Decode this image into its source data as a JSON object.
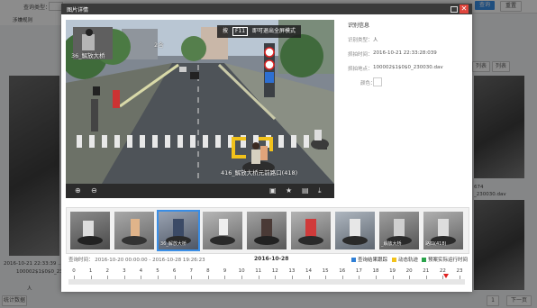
{
  "background": {
    "filter_label_1": "查询类型：",
    "filter_label_2": "涉嫌规则",
    "btn_query": "查询",
    "btn_reset": "重置",
    "view_tab_list": "列表",
    "view_tab_grid": "列表",
    "left_time": "2016-10-21 22:33:39 ...",
    "left_file": "100002$1$0$0_23...",
    "left_tag": "人",
    "right_file": "_230030.dav",
    "right_num": "674",
    "stat_label": "统计数据",
    "page_num": "1",
    "next_label": "下一页"
  },
  "dialog": {
    "title": "图片详情",
    "close_glyph": "✕",
    "tooltip": {
      "prefix": "按",
      "key": "F11",
      "suffix": "即可退出全屏模式"
    },
    "watermark_top": "36_解放大桥",
    "watermark_top_right": "2合",
    "watermark_bottom": "416_解放大桥元前路口(418)",
    "video_tools": [
      "zoom-in",
      "zoom-out",
      "crop",
      "star",
      "image",
      "download"
    ],
    "info": {
      "title": "识别信息",
      "type_label": "识别类型：",
      "type_value": "人",
      "time_label": "抓拍时间：",
      "time_value": "2016-10-21 22:33:28:039",
      "place_label": "抓拍地点：",
      "place_value": "100002$1$0$0_230030.dav",
      "color_label": "颜色："
    },
    "thumbs": [
      {
        "label": ""
      },
      {
        "label": ""
      },
      {
        "label": "36_解放大桥"
      },
      {
        "label": ""
      },
      {
        "label": ""
      },
      {
        "label": ""
      },
      {
        "label": ""
      },
      {
        "label": "_解放大桥"
      },
      {
        "label": "路口(418)"
      }
    ],
    "query_time_label": "查询时间：",
    "query_time_value": "2016-10-20 00:00:00  -  2016-10-28 19:26:23",
    "current_date": "2016-10-28",
    "legend": [
      {
        "label": "查询结果跟踪",
        "color": "#2f7fd6"
      },
      {
        "label": "动态轨迹",
        "color": "#f2c21b"
      },
      {
        "label": "预案实际运行时间",
        "color": "#2aa34a"
      }
    ],
    "timeline_hours": [
      "0",
      "1",
      "2",
      "3",
      "4",
      "5",
      "6",
      "7",
      "8",
      "9",
      "10",
      "11",
      "12",
      "13",
      "14",
      "15",
      "16",
      "17",
      "18",
      "19",
      "20",
      "21",
      "22",
      "23"
    ],
    "cursor_hour": 22.2
  }
}
